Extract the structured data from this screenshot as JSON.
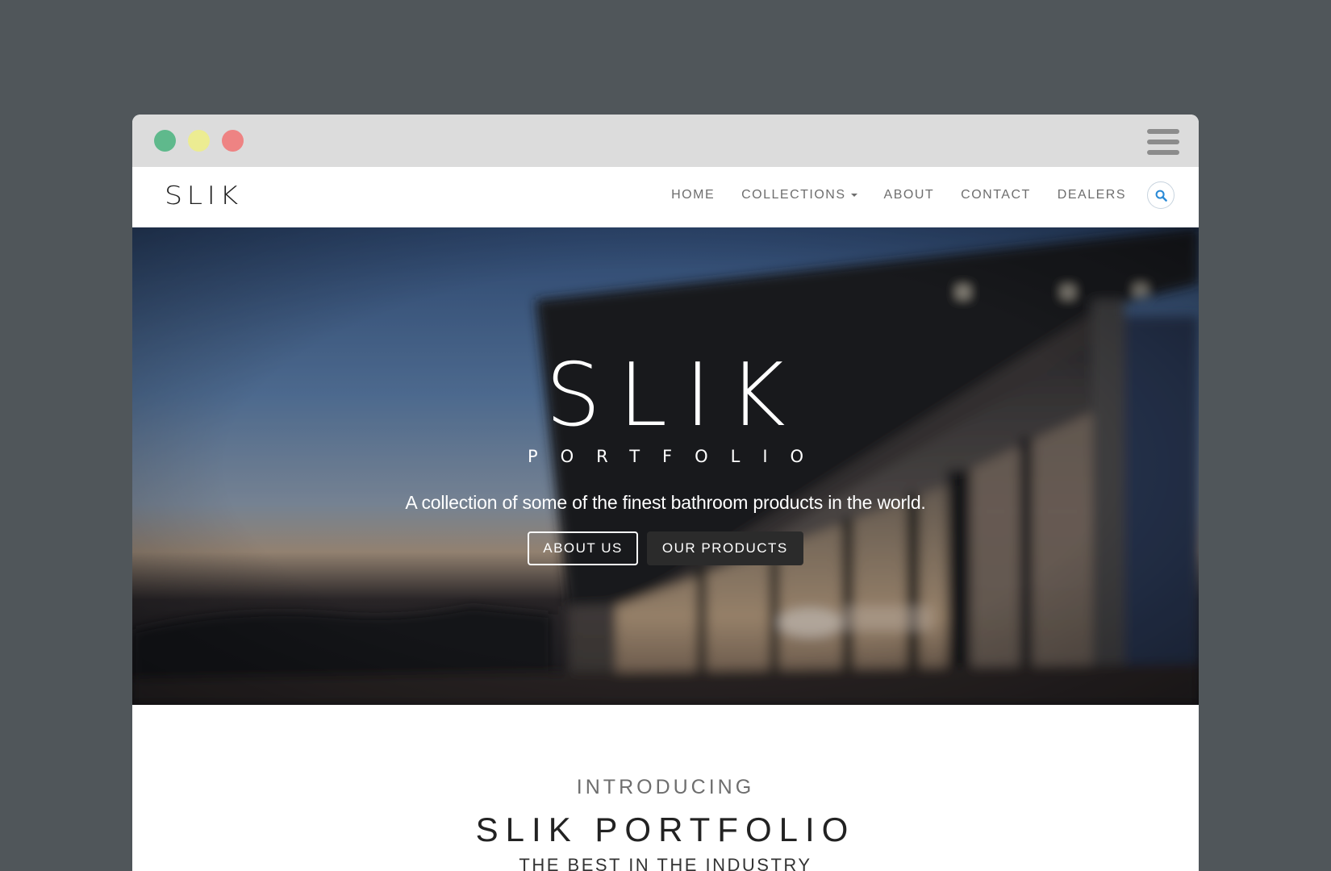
{
  "window": {
    "controls": {
      "green": "#5fb98c",
      "yellow": "#ecec92",
      "red": "#ee8383"
    },
    "menu_icon": "hamburger-menu-icon"
  },
  "navbar": {
    "brand": "SLIK",
    "items": [
      {
        "label": "HOME"
      },
      {
        "label": "COLLECTIONS",
        "has_dropdown": true
      },
      {
        "label": "ABOUT"
      },
      {
        "label": "CONTACT"
      },
      {
        "label": "DEALERS"
      }
    ],
    "search_icon": "search-icon",
    "search_icon_color": "#2a8ad6"
  },
  "hero": {
    "title": "SLIK",
    "subtitle": "PORTFOLIO",
    "tagline": "A collection of some of the finest bathroom products in the world.",
    "buttons": {
      "about": "ABOUT US",
      "products": "OUR PRODUCTS"
    }
  },
  "intro": {
    "kicker": "INTRODUCING",
    "title": "SLIK PORTFOLIO",
    "subtitle": "THE BEST IN THE INDUSTRY"
  }
}
